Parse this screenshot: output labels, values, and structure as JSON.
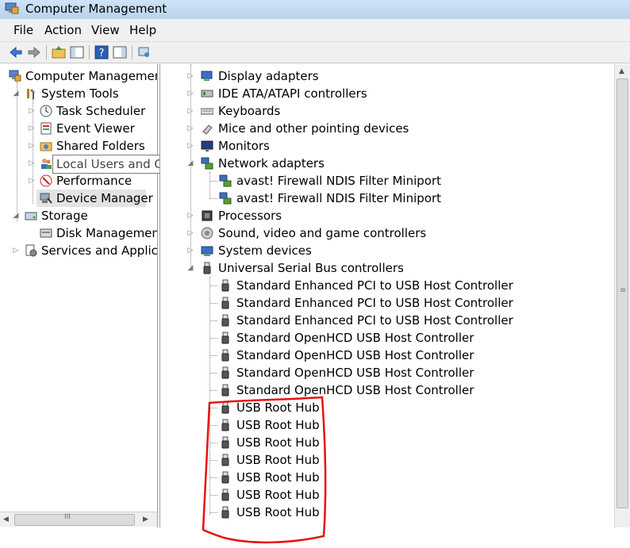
{
  "window": {
    "title": "Computer Management"
  },
  "menu": {
    "items": [
      "File",
      "Action",
      "View",
      "Help"
    ]
  },
  "toolbar": {
    "icons": [
      "back-arrow-icon",
      "forward-arrow-icon",
      "up-folder-icon",
      "show-hide-tree-icon",
      "help-icon",
      "show-hide-action-pane-icon",
      "properties-icon"
    ]
  },
  "left_tree": {
    "root": "Computer Management",
    "system_tools": "System Tools",
    "task_scheduler": "Task Scheduler",
    "event_viewer": "Event Viewer",
    "shared_folders": "Shared Folders",
    "local_users": "Local Users and Groups",
    "performance": "Performance",
    "device_manager": "Device Manager",
    "storage": "Storage",
    "disk_management": "Disk Management",
    "services": "Services and Applicat"
  },
  "device_tree": {
    "display_adapters": "Display adapters",
    "ide": "IDE ATA/ATAPI controllers",
    "keyboards": "Keyboards",
    "mice": "Mice and other pointing devices",
    "monitors": "Monitors",
    "network_adapters": "Network adapters",
    "network_children": [
      "avast! Firewall NDIS Filter Miniport",
      "avast! Firewall NDIS Filter Miniport"
    ],
    "processors": "Processors",
    "sound": "Sound, video and game controllers",
    "system_devices": "System devices",
    "usb": "Universal Serial Bus controllers",
    "usb_children": [
      "Standard Enhanced PCI to USB Host Controller",
      "Standard Enhanced PCI to USB Host Controller",
      "Standard Enhanced PCI to USB Host Controller",
      "Standard OpenHCD USB Host Controller",
      "Standard OpenHCD USB Host Controller",
      "Standard OpenHCD USB Host Controller",
      "Standard OpenHCD USB Host Controller",
      "USB Root Hub",
      "USB Root Hub",
      "USB Root Hub",
      "USB Root Hub",
      "USB Root Hub",
      "USB Root Hub",
      "USB Root Hub"
    ]
  },
  "scrollbar": {
    "h_grip": "III"
  },
  "colors": {
    "annotation": "#e8100c",
    "selection": "#e3e3e3"
  }
}
